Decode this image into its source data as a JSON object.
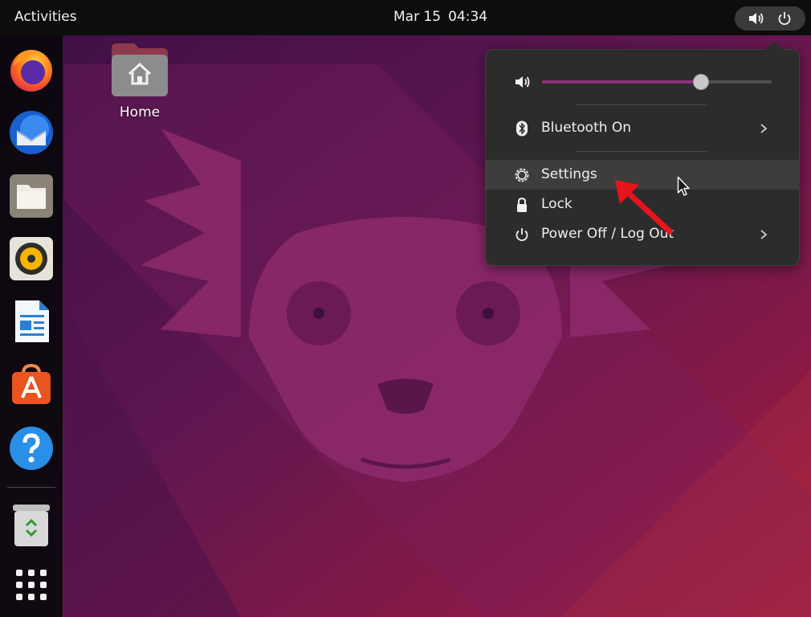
{
  "topbar": {
    "activities_label": "Activities",
    "date": "Mar 15",
    "time": "04:34",
    "indicators": [
      "speaker-icon",
      "power-icon"
    ]
  },
  "dock": {
    "apps": [
      {
        "name": "firefox-icon"
      },
      {
        "name": "thunderbird-icon"
      },
      {
        "name": "files-icon"
      },
      {
        "name": "rhythmbox-icon"
      },
      {
        "name": "libreoffice-writer-icon"
      },
      {
        "name": "ubuntu-software-icon"
      },
      {
        "name": "help-icon"
      },
      {
        "name": "trash-icon"
      },
      {
        "name": "show-applications-icon"
      }
    ]
  },
  "desktop": {
    "home_label": "Home"
  },
  "system_menu": {
    "volume": {
      "icon": "speaker-icon",
      "level": 0.69
    },
    "bluetooth": {
      "label": "Bluetooth On",
      "icon": "bluetooth-icon",
      "has_submenu": true
    },
    "settings": {
      "label": "Settings",
      "icon": "settings-gear-icon",
      "highlighted": true
    },
    "lock": {
      "label": "Lock",
      "icon": "lock-icon"
    },
    "power": {
      "label": "Power Off / Log Out",
      "icon": "power-icon",
      "has_submenu": true
    }
  },
  "colors": {
    "accent": "#8e2f7e",
    "menu_bg": "#2c2c2c",
    "annotation_arrow": "#e8141c"
  }
}
